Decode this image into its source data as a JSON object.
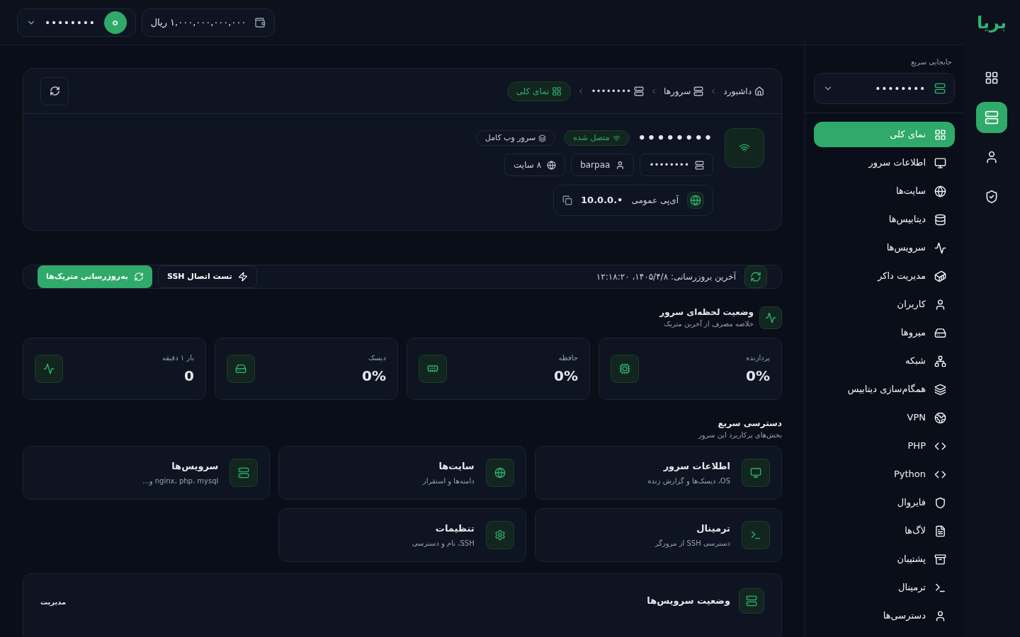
{
  "logo": "بریا",
  "rail": [
    {
      "selected": false
    },
    {
      "selected": true
    },
    {
      "selected": false
    },
    {
      "selected": false
    }
  ],
  "topbar": {
    "user": {
      "avatar": "o",
      "name": "••••••••"
    },
    "balance": "۱,۰۰۰,۰۰۰,۰۰۰,۰۰۰ ریال"
  },
  "sidebar": {
    "switch_label": "جابجایی سریع",
    "switch_value": "••••••••",
    "items": [
      {
        "label": "نمای کلی",
        "selected": true
      },
      {
        "label": "اطلاعات سرور",
        "selected": false
      },
      {
        "label": "سایت‌ها",
        "selected": false
      },
      {
        "label": "دیتابیس‌ها",
        "selected": false
      },
      {
        "label": "سرویس‌ها",
        "selected": false
      },
      {
        "label": "مدیریت داکر",
        "selected": false
      },
      {
        "label": "کاربران",
        "selected": false
      },
      {
        "label": "میروها",
        "selected": false
      },
      {
        "label": "شبکه",
        "selected": false
      },
      {
        "label": "همگام‌سازی دیتابیس",
        "selected": false
      },
      {
        "label": "VPN",
        "selected": false
      },
      {
        "label": "PHP",
        "selected": false
      },
      {
        "label": "Python",
        "selected": false
      },
      {
        "label": "فایروال",
        "selected": false
      },
      {
        "label": "لاگ‌ها",
        "selected": false
      },
      {
        "label": "پشتیبان",
        "selected": false
      },
      {
        "label": "ترمینال",
        "selected": false
      },
      {
        "label": "دسترسی‌ها",
        "selected": false
      }
    ]
  },
  "breadcrumb": [
    {
      "label": "داشبورد",
      "selected": false
    },
    {
      "label": "سرورها",
      "selected": false
    },
    {
      "label": "••••••••",
      "selected": false
    },
    {
      "label": "نمای کلی",
      "selected": true
    }
  ],
  "server": {
    "name": "••••••••",
    "status": "متصل شده",
    "connected": true,
    "type": "سرور وب کامل",
    "chips": [
      "••••••••",
      "barpaa",
      "۸ سایت"
    ],
    "ip_label": "آی‌پی عمومی",
    "ip": "10.0.0.•"
  },
  "actions": {
    "last_update": "آخرین بروزرسانی: ۱۴۰۵/۴/۸، ۱۲:۱۸:۲۰",
    "buttons": [
      {
        "label": "تست اتصال SSH",
        "kind": "secondary"
      },
      {
        "label": "به‌روزرسانی متریک‌ها",
        "kind": "primary"
      }
    ]
  },
  "live": {
    "title": "وضعیت لحظه‌ای سرور",
    "subtitle": "خلاصه مصرف از آخرین متریک",
    "metrics": [
      {
        "label": "پردازنده",
        "value": "0%"
      },
      {
        "label": "حافظه",
        "value": "0%"
      },
      {
        "label": "دیسک",
        "value": "0%"
      },
      {
        "label": "بار ۱ دقیقه",
        "value": "0"
      }
    ]
  },
  "quick": {
    "title": "دسترسی سریع",
    "subtitle": "بخش‌های پرکاربرد این سرور",
    "cards": [
      {
        "title": "اطلاعات سرور",
        "desc": "OS، دیسک‌ها و گزارش زنده"
      },
      {
        "title": "سایت‌ها",
        "desc": "دامنه‌ها و استقرار"
      },
      {
        "title": "سرویس‌ها",
        "desc": "nginx، php، mysql و..."
      },
      {
        "title": "ترمینال",
        "desc": "دسترسی SSH از مرورگر"
      },
      {
        "title": "تنظیمات",
        "desc": "SSH، نام و دسترسی"
      }
    ]
  },
  "services": {
    "title": "وضعیت سرویس‌ها",
    "link": "مدیریت"
  }
}
